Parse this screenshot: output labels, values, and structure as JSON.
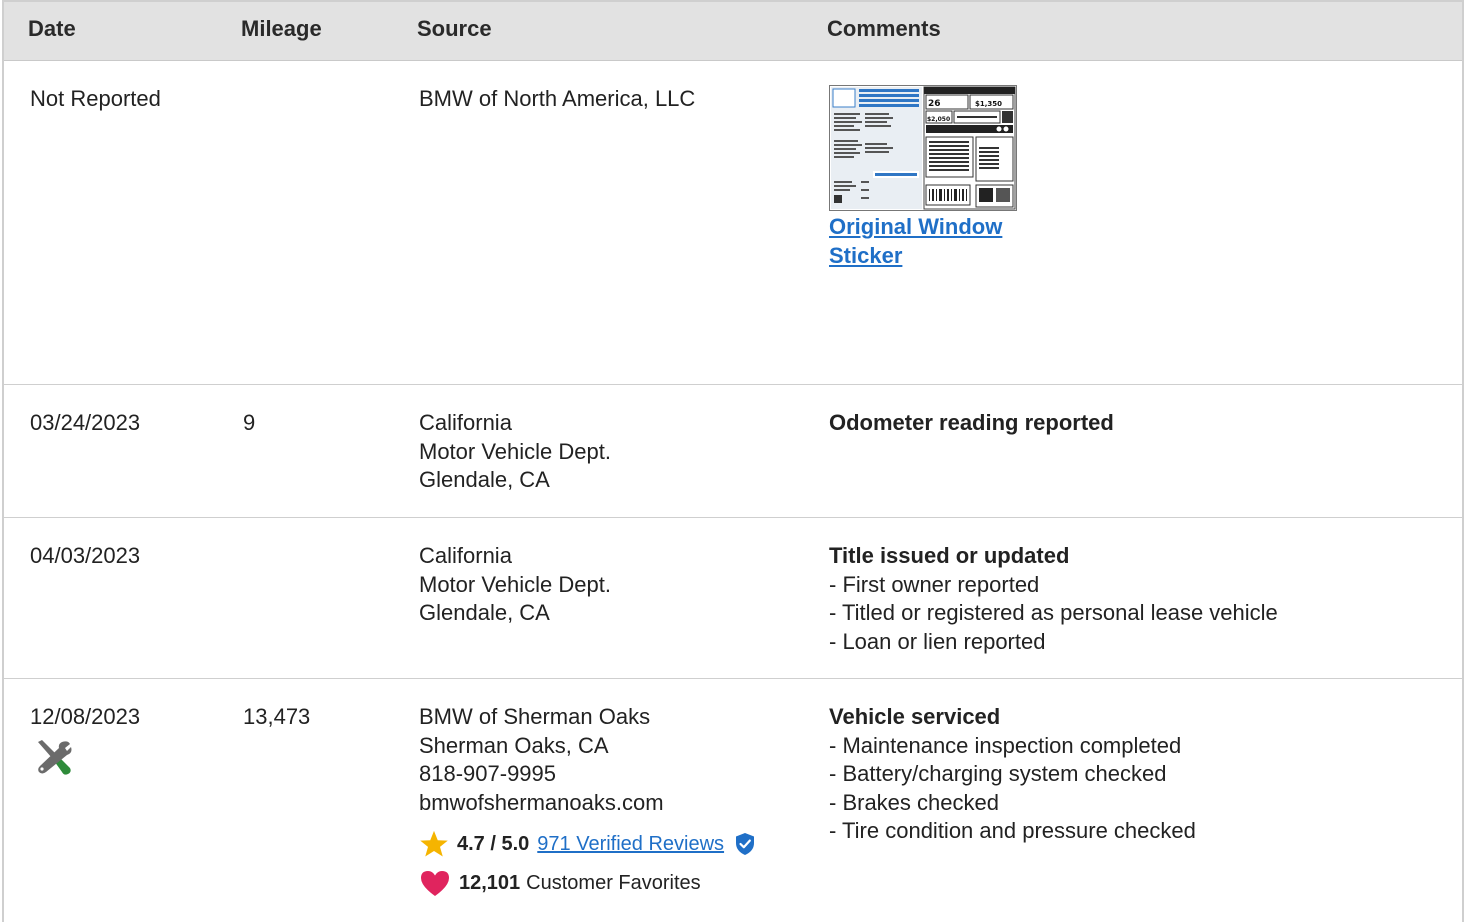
{
  "header": {
    "date": "Date",
    "mileage": "Mileage",
    "source": "Source",
    "comments": "Comments"
  },
  "rows": [
    {
      "date": "Not Reported",
      "mileage": "",
      "source": [
        "BMW of North America, LLC"
      ],
      "sticker_link": [
        "Original Window",
        "Sticker"
      ]
    },
    {
      "date": "03/24/2023",
      "mileage": "9",
      "source": [
        "California",
        "Motor Vehicle Dept.",
        "Glendale, CA"
      ],
      "comment_title": "Odometer reading reported"
    },
    {
      "date": "04/03/2023",
      "mileage": "",
      "source": [
        "California",
        "Motor Vehicle Dept.",
        "Glendale, CA"
      ],
      "comment_title": "Title issued or updated",
      "comment_items": [
        "- First owner reported",
        "- Titled or registered as personal lease vehicle",
        "- Loan or lien reported"
      ]
    },
    {
      "date": "12/08/2023",
      "mileage": "13,473",
      "source": [
        "BMW of Sherman Oaks",
        "Sherman Oaks, CA",
        "818-907-9995",
        "bmwofshermanoaks.com"
      ],
      "rating": "4.7 / 5.0",
      "reviews_link": "971 Verified Reviews",
      "favorites_count": "12,101",
      "favorites_label": "Customer Favorites",
      "comment_title": "Vehicle serviced",
      "comment_items": [
        "- Maintenance inspection completed",
        "- Battery/charging system checked",
        "- Brakes checked",
        "- Tire condition and pressure checked"
      ]
    }
  ],
  "colors": {
    "header_bg": "#e2e2e2",
    "link": "#1f6fc7",
    "star": "#f5b400",
    "heart": "#e0245e",
    "verified": "#1f6fc7",
    "service_icon_green": "#2e8b3a"
  },
  "icons": {
    "service": "wrench-screwdriver-icon",
    "rating": "star-icon",
    "verified": "verified-badge-icon",
    "favorites": "heart-icon"
  }
}
